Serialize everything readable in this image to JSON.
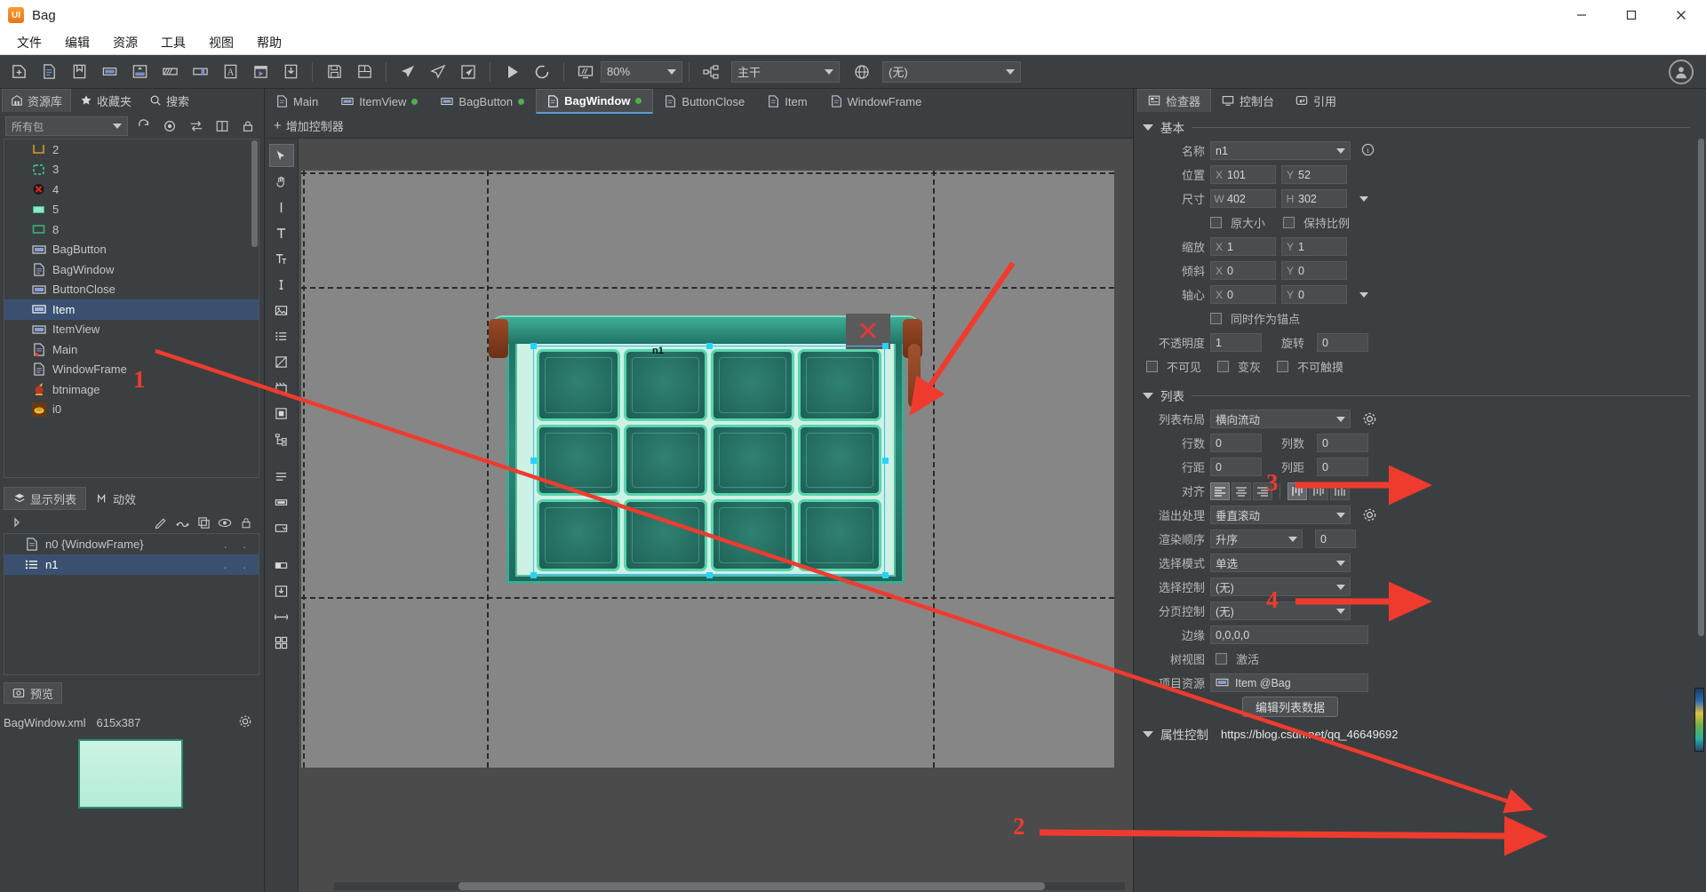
{
  "window": {
    "title": "Bag",
    "logo_text": "UI",
    "minimize_label": "—",
    "maximize_label": "⬜",
    "close_label": "✕"
  },
  "menubar": {
    "items": [
      {
        "label": "文件",
        "name": "menu-file"
      },
      {
        "label": "编辑",
        "name": "menu-edit"
      },
      {
        "label": "资源",
        "name": "menu-resource"
      },
      {
        "label": "工具",
        "name": "menu-tools"
      },
      {
        "label": "视图",
        "name": "menu-view"
      },
      {
        "label": "帮助",
        "name": "menu-help"
      }
    ]
  },
  "toolbar": {
    "icons": [
      "new-file-icon",
      "new-document-icon",
      "bookmark-icon",
      "new-button-icon",
      "new-label-icon",
      "new-progress-icon",
      "new-slider-icon",
      "new-text-icon",
      "new-movieclip-icon",
      "import-icon"
    ],
    "icons2": [
      "save-icon",
      "save-all-icon"
    ],
    "icons3": [
      "publish-icon",
      "publish-all-icon",
      "publish-settings-icon"
    ],
    "icons4": [
      "run-icon",
      "refresh-icon"
    ],
    "zoom_icon": "screen-icon",
    "zoom_value": "80%",
    "branch_icon": "branch-icon",
    "branch_value": "主干",
    "lang_icon": "globe-icon",
    "lang_value": "(无)",
    "avatar_icon": "user-avatar-icon"
  },
  "library": {
    "tabs": [
      {
        "label": "资源库",
        "icon": "library-icon",
        "active": true
      },
      {
        "label": "收藏夹",
        "icon": "star-icon",
        "active": false
      },
      {
        "label": "搜索",
        "icon": "search-icon",
        "active": false
      }
    ],
    "filter_value": "所有包",
    "filter_icons": [
      "refresh-icon",
      "locate-icon",
      "sort-icon",
      "split-view-icon",
      "lock-icon"
    ],
    "tree": [
      {
        "label": "2",
        "icon": "component-outline-icon",
        "selected": false
      },
      {
        "label": "3",
        "icon": "component-dashed-icon",
        "selected": false
      },
      {
        "label": "4",
        "icon": "close-image-icon",
        "selected": false
      },
      {
        "label": "5",
        "icon": "fill-swatch-icon",
        "selected": false
      },
      {
        "label": "8",
        "icon": "outline-swatch-icon",
        "selected": false
      },
      {
        "label": "BagButton",
        "icon": "component-icon",
        "selected": false
      },
      {
        "label": "BagWindow",
        "icon": "document-icon",
        "selected": false
      },
      {
        "label": "ButtonClose",
        "icon": "component-icon",
        "selected": false
      },
      {
        "label": "Item",
        "icon": "component-icon",
        "selected": true
      },
      {
        "label": "ItemView",
        "icon": "component-icon",
        "selected": false
      },
      {
        "label": "Main",
        "icon": "document-modified-icon",
        "selected": false
      },
      {
        "label": "WindowFrame",
        "icon": "document-icon",
        "selected": false
      },
      {
        "label": "btnimage",
        "icon": "image-icon",
        "selected": false
      },
      {
        "label": "i0",
        "icon": "image-icon",
        "selected": false
      }
    ]
  },
  "display_list": {
    "tabs": [
      {
        "label": "显示列表",
        "icon": "layers-icon",
        "active": true
      },
      {
        "label": "动效",
        "icon": "animation-icon",
        "active": false
      }
    ],
    "toolbar_icons": [
      "expand-icon",
      "edit-icon",
      "link-icon",
      "copy-icon",
      "eye-icon",
      "lock-icon"
    ],
    "rows": [
      {
        "label": "n0 {WindowFrame}",
        "icon": "document-icon",
        "selected": false,
        "dots": [
          ".",
          "."
        ]
      },
      {
        "label": "n1",
        "icon": "list-icon",
        "selected": true,
        "dots": [
          ".",
          "."
        ]
      }
    ]
  },
  "preview": {
    "tab_label": "预览",
    "tab_icon": "preview-icon",
    "file_name": "BagWindow.xml",
    "dimensions": "615x387",
    "gear_icon": "gear-icon"
  },
  "editor": {
    "tabs": [
      {
        "label": "Main",
        "icon": "document-icon",
        "modified": false,
        "active": false
      },
      {
        "label": "ItemView",
        "icon": "component-icon",
        "modified": true,
        "active": false
      },
      {
        "label": "BagButton",
        "icon": "component-icon",
        "modified": true,
        "active": false
      },
      {
        "label": "BagWindow",
        "icon": "document-icon",
        "modified": true,
        "active": true
      },
      {
        "label": "ButtonClose",
        "icon": "component-icon",
        "modified": false,
        "active": false
      },
      {
        "label": "Item",
        "icon": "component-icon",
        "modified": false,
        "active": false
      },
      {
        "label": "WindowFrame",
        "icon": "document-icon",
        "modified": false,
        "active": false
      }
    ],
    "add_controller_label": "增加控制器",
    "add_controller_plus": "+",
    "vtool_icons": [
      "select-tool-icon",
      "hand-tool-icon",
      "line-tool-icon",
      "text-tool-icon",
      "rich-text-tool-icon",
      "input-text-tool-icon",
      "loader-tool-icon",
      "list-tool-icon",
      "graph-tool-icon",
      "movieclip-tool-icon",
      "component-tool-icon",
      "tree-tool-icon",
      "label-tool-icon",
      "button-tool-icon",
      "combobox-tool-icon",
      "progress-tool-icon",
      "slider-tool-icon",
      "scrollbar-tool-icon",
      "group-tool-icon"
    ],
    "selection_label": "n1"
  },
  "inspector": {
    "tabs": [
      {
        "label": "检查器",
        "icon": "inspector-icon",
        "active": true
      },
      {
        "label": "控制台",
        "icon": "console-icon",
        "active": false
      },
      {
        "label": "引用",
        "icon": "reference-icon",
        "active": false
      }
    ],
    "basic": {
      "section_label": "基本",
      "name_label": "名称",
      "name_value": "n1",
      "info_icon": "info-icon",
      "position_label": "位置",
      "position_x": "101",
      "position_y": "52",
      "size_label": "尺寸",
      "size_w": "402",
      "size_h": "302",
      "original_size_label": "原大小",
      "keep_ratio_label": "保持比例",
      "scale_label": "缩放",
      "scale_x": "1",
      "scale_y": "1",
      "skew_label": "倾斜",
      "skew_x": "0",
      "skew_y": "0",
      "pivot_label": "轴心",
      "pivot_x": "0",
      "pivot_y": "0",
      "as_anchor_label": "同时作为锚点",
      "opacity_label": "不透明度",
      "opacity_value": "1",
      "rotation_label": "旋转",
      "rotation_value": "0",
      "invisible_label": "不可见",
      "gray_label": "变灰",
      "untouchable_label": "不可触摸",
      "prefix_x": "X",
      "prefix_y": "Y",
      "prefix_w": "W",
      "prefix_h": "H"
    },
    "list": {
      "section_label": "列表",
      "layout_label": "列表布局",
      "layout_value": "横向流动",
      "rows_label": "行数",
      "rows_value": "0",
      "cols_label": "列数",
      "cols_value": "0",
      "rowgap_label": "行距",
      "rowgap_value": "0",
      "colgap_label": "列距",
      "colgap_value": "0",
      "align_label": "对齐",
      "overflow_label": "溢出处理",
      "overflow_value": "垂直滚动",
      "render_order_label": "渲染顺序",
      "render_order_value": "升序",
      "render_order_num": "0",
      "select_mode_label": "选择模式",
      "select_mode_value": "单选",
      "select_ctrl_label": "选择控制",
      "select_ctrl_value": "(无)",
      "page_ctrl_label": "分页控制",
      "page_ctrl_value": "(无)",
      "margin_label": "边缘",
      "margin_value": "0,0,0,0",
      "treeview_label": "树视图",
      "active_label": "激活",
      "item_res_label": "项目资源",
      "item_res_value": "Item @Bag",
      "item_res_icon": "component-icon",
      "edit_data_label": "编辑列表数据",
      "gear_icon": "gear-icon"
    },
    "footer": {
      "section_label": "属性控制",
      "watermark": "https://blog.csdn.net/qq_46649692"
    }
  },
  "annotations": [
    {
      "number": "1",
      "name": "annotation-1"
    },
    {
      "number": "2",
      "name": "annotation-2"
    },
    {
      "number": "3",
      "name": "annotation-3"
    },
    {
      "number": "4",
      "name": "annotation-4"
    }
  ],
  "colors": {
    "accent": "#5b9dd9",
    "selection": "#3a5070",
    "annotation_red": "#ef3b2d",
    "panel_bg": "#3c3f41",
    "canvas_bg": "#4b4b4b",
    "stage_bg": "#868686"
  }
}
